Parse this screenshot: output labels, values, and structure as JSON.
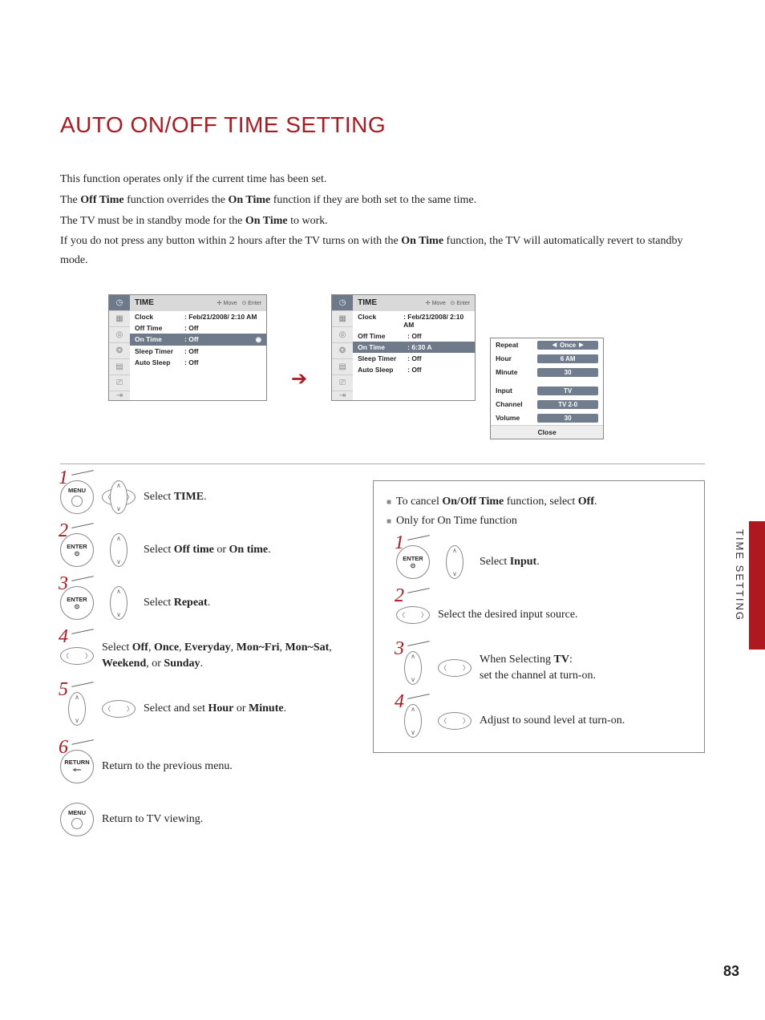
{
  "title": "AUTO ON/OFF TIME SETTING",
  "intro": {
    "l1a": "This function operates only if the current time has been set.",
    "l2a": "The ",
    "l2b": "Off Time",
    "l2c": " function overrides the ",
    "l2d": "On Time",
    "l2e": " function if they are both set to the same time.",
    "l3a": "The TV must be in standby mode for the ",
    "l3b": "On Time",
    "l3c": " to work.",
    "l4a": "If you do not press any button within 2 hours after the TV turns on with the ",
    "l4b": "On Time",
    "l4c": " function, the TV will automatically revert to standby mode."
  },
  "osd": {
    "header": "TIME",
    "hint_move": "Move",
    "hint_enter": "Enter",
    "rows": {
      "clock_l": "Clock",
      "clock_v": "Feb/21/2008/ 2:10 AM",
      "off_l": "Off Time",
      "off_v": "Off",
      "on_l": "On Time",
      "on_v1": "Off",
      "on_v2": "6:30 A",
      "sleep_l": "Sleep Timer",
      "sleep_v": "Off",
      "auto_l": "Auto Sleep",
      "auto_v": "Off"
    }
  },
  "submenu": {
    "repeat_k": "Repeat",
    "repeat_v": "Once",
    "hour_k": "Hour",
    "hour_v": "6 AM",
    "minute_k": "Minute",
    "minute_v": "30",
    "input_k": "Input",
    "input_v": "TV",
    "channel_k": "Channel",
    "channel_v": "TV 2-0",
    "volume_k": "Volume",
    "volume_v": "30",
    "close": "Close"
  },
  "buttons": {
    "menu": "MENU",
    "enter": "ENTER",
    "return": "RETURN"
  },
  "steps_left": {
    "n1": "1",
    "s1a": "Select ",
    "s1b": "TIME",
    "s1c": ".",
    "n2": "2",
    "s2a": "Select ",
    "s2b": "Off time",
    "s2c": " or ",
    "s2d": "On time",
    "s2e": ".",
    "n3": "3",
    "s3a": "Select ",
    "s3b": "Repeat",
    "s3c": ".",
    "n4": "4",
    "s4a": "Select ",
    "s4b": "Off",
    "s4c": ", ",
    "s4d": "Once",
    "s4e": ", ",
    "s4f": "Everyday",
    "s4g": ", ",
    "s4h": "Mon~Fri",
    "s4i": ", ",
    "s4j": "Mon~Sat",
    "s4k": ", ",
    "s4l": "Weekend",
    "s4m": ", or ",
    "s4n": "Sunday",
    "s4o": ".",
    "n5": "5",
    "s5a": "Select and set ",
    "s5b": "Hour",
    "s5c": " or ",
    "s5d": "Minute",
    "s5e": ".",
    "n6": "6",
    "s6a": "Return to the previous menu.",
    "s7a": "Return to TV viewing."
  },
  "steps_right": {
    "note1a": "To cancel ",
    "note1b": "On/Off Time",
    "note1c": " function, select ",
    "note1d": "Off",
    "note1e": ".",
    "note2": "Only for On Time function",
    "n1": "1",
    "r1a": "Select ",
    "r1b": "Input",
    "r1c": ".",
    "n2": "2",
    "r2": "Select the desired input source.",
    "n3": "3",
    "r3a": "When Selecting ",
    "r3b": "TV",
    "r3c": ":",
    "r3d": "set the channel at turn-on.",
    "n4": "4",
    "r4": "Adjust to sound level at turn-on."
  },
  "side_label": "TIME SETTING",
  "page_num": "83"
}
